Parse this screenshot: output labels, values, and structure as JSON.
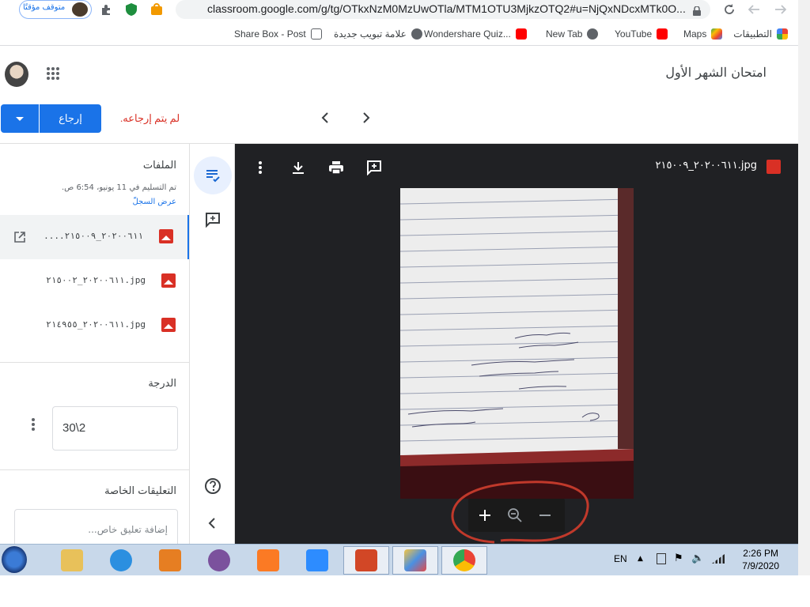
{
  "browser": {
    "profile_label": "متوقف مؤقتًا",
    "url": "classroom.google.com/g/tg/OTkxNzM0MzUwOTla/MTM1OTU3MjkzOTQ2#u=NjQxNDcxMTk0O...",
    "bookmarks": [
      {
        "label": "التطبيقات",
        "icon": "apps-grid-icon"
      },
      {
        "label": "Maps",
        "icon": "maps-icon"
      },
      {
        "label": "YouTube",
        "icon": "youtube-icon"
      },
      {
        "label": "New Tab",
        "icon": "globe-icon"
      },
      {
        "label": "Wondershare Quiz...",
        "icon": "youtube-icon"
      },
      {
        "label": "علامة تبويب جديدة",
        "icon": "globe-icon"
      },
      {
        "label": "Share Box - Post",
        "icon": "box-icon"
      }
    ]
  },
  "header": {
    "title": "امتحان الشهر الأول"
  },
  "actions": {
    "return_label": "إرجاع",
    "status": "لم يتم إرجاعه."
  },
  "files_panel": {
    "heading": "الملفات",
    "submitted": "تم التسليم في 11 يونيو، 6:54 ص.",
    "history_link": "عرض السجلّ",
    "files": [
      {
        "name": "....٢٠٢٠٠٦١١_٢١٥٠٠٩",
        "selected": true
      },
      {
        "name": "٢٠٢٠٠٦١١_٢١٥٠٠٢.jpg",
        "selected": false
      },
      {
        "name": "٢٠٢٠٠٦١١_٢١٤٩٥٥.jpg",
        "selected": false
      }
    ],
    "grade_heading": "الدرجة",
    "grade_value": "30\\2",
    "private_heading": "التعليقات الخاصة",
    "private_placeholder": "إضافة تعليق خاص..."
  },
  "viewer": {
    "file_title": "٢٠٢٠٠٦١١_٢١٥٠٠٩.jpg"
  },
  "taskbar": {
    "language": "EN",
    "time": "2:26 PM",
    "date": "7/9/2020"
  },
  "colors": {
    "accent": "#1a73e8",
    "error": "#d93025",
    "viewer_bg": "#202124"
  }
}
